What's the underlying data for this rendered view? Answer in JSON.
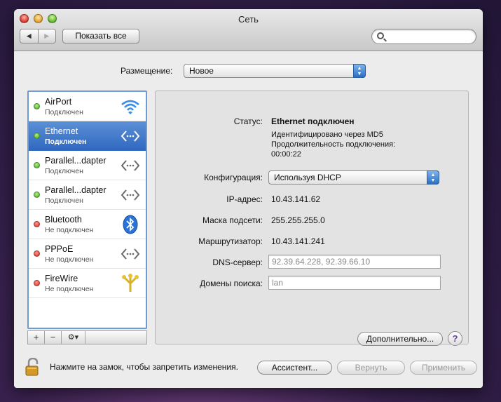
{
  "window": {
    "title": "Сеть"
  },
  "toolbar": {
    "back_label": "◀",
    "forward_label": "▶",
    "show_all_label": "Показать все",
    "search_placeholder": ""
  },
  "location": {
    "label": "Размещение:",
    "value": "Новое"
  },
  "services": [
    {
      "name": "AirPort",
      "status": "Подключен",
      "state": "connected",
      "icon": "wifi-icon"
    },
    {
      "name": "Ethernet",
      "status": "Подключен",
      "state": "connected",
      "icon": "ethernet-icon",
      "selected": true
    },
    {
      "name": "Parallel...dapter",
      "status": "Подключен",
      "state": "connected",
      "icon": "ethernet-icon"
    },
    {
      "name": "Parallel...dapter",
      "status": "Подключен",
      "state": "connected",
      "icon": "ethernet-icon"
    },
    {
      "name": "Bluetooth",
      "status": "Не подключен",
      "state": "disconnected",
      "icon": "bluetooth-icon"
    },
    {
      "name": "PPPoE",
      "status": "Не подключен",
      "state": "disconnected",
      "icon": "ethernet-icon"
    },
    {
      "name": "FireWire",
      "status": "Не подключен",
      "state": "disconnected",
      "icon": "firewire-icon"
    }
  ],
  "list_toolbar": {
    "add": "+",
    "remove": "−",
    "gear": "⚙▾"
  },
  "detail": {
    "status_label": "Статус:",
    "status_value": "Ethernet подключен",
    "status_line1": "Идентифицировано через MD5",
    "status_line2": "Продолжительность подключения:",
    "status_line3": "00:00:22",
    "config_label": "Конфигурация:",
    "config_value": "Используя DHCP",
    "ip_label": "IP-адрес:",
    "ip_value": "10.43.141.62",
    "mask_label": "Маска подсети:",
    "mask_value": "255.255.255.0",
    "router_label": "Маршрутизатор:",
    "router_value": "10.43.141.241",
    "dns_label": "DNS-сервер:",
    "dns_value": "92.39.64.228, 92.39.66.10",
    "search_domains_label": "Домены поиска:",
    "search_domains_value": "lan",
    "advanced_label": "Дополнительно...",
    "help_label": "?"
  },
  "footer": {
    "lock_text": "Нажмите на замок, чтобы запретить изменения.",
    "assistant_label": "Ассистент...",
    "revert_label": "Вернуть",
    "apply_label": "Применить"
  },
  "colors": {
    "selection": "#3b74c8",
    "connected": "#3da419",
    "disconnected": "#d0231a"
  }
}
